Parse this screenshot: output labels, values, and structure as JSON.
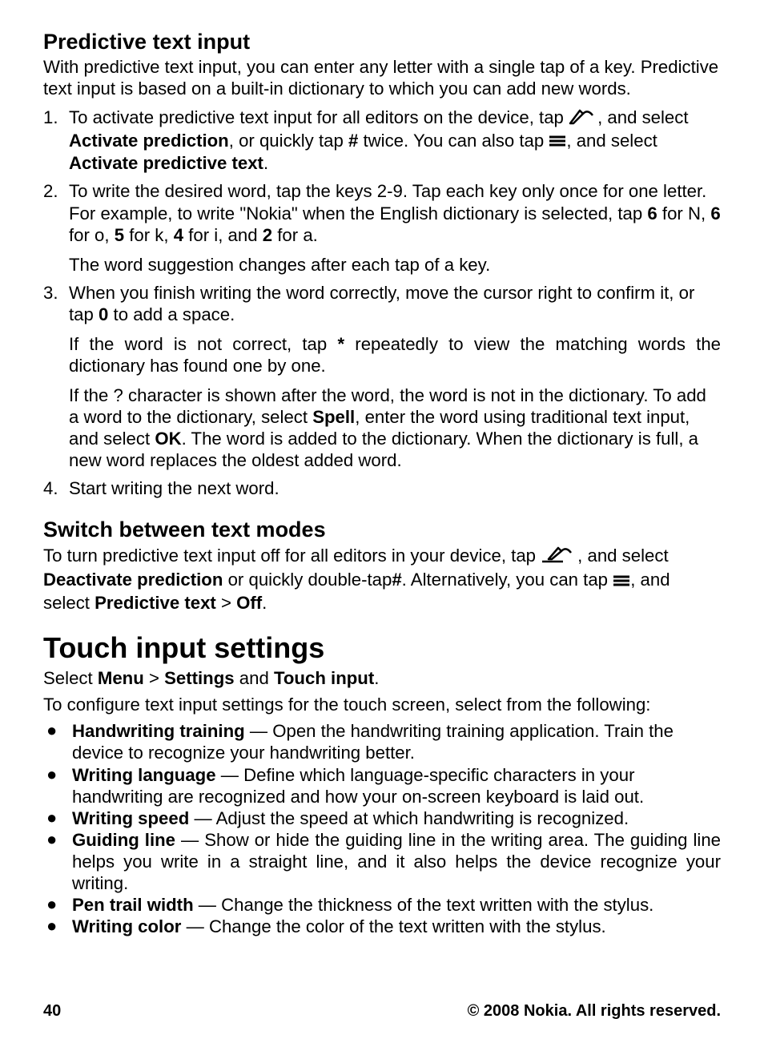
{
  "section1": {
    "heading": "Predictive text input",
    "intro": "With predictive text input, you can enter any letter with a single tap of a key. Predictive text input is based on a built-in dictionary to which you can add new words.",
    "steps": [
      {
        "num": "1.",
        "pre": "To activate predictive text input for all editors on the device, tap ",
        "mid1": ", and select ",
        "b1": "Activate prediction",
        "mid2": ", or quickly tap ",
        "b2": "#",
        "mid3": " twice. You can also tap ",
        "mid4": ", and select ",
        "b3": "Activate predictive text",
        "tail": "."
      },
      {
        "num": "2.",
        "p1a": "To write the desired word, tap the keys 2-9. Tap each key only once for one letter. For example, to write \"Nokia\" when the English dictionary is selected, tap ",
        "k6": "6",
        "t6": " for N, ",
        "k6b": "6",
        "t6b": " for o, ",
        "k5": "5",
        "t5": " for k, ",
        "k4": "4",
        "t4": " for i, and ",
        "k2": "2",
        "t2": " for a.",
        "p2": "The word suggestion changes after each tap of a key."
      },
      {
        "num": "3.",
        "p1a": "When you finish writing the word correctly, move the cursor right to confirm it, or tap ",
        "k0": "0",
        "p1b": " to add a space.",
        "p2a": "If the word is not correct, tap ",
        "kstar": "*",
        "p2b": " repeatedly to view the matching words the dictionary has found one by one.",
        "p3a": "If the ? character is shown after the word, the word is not in the dictionary. To add a word to the dictionary, select ",
        "spell": "Spell",
        "p3b": ", enter the word using traditional text input, and select ",
        "ok": "OK",
        "p3c": ". The word is added to the dictionary. When the dictionary is full, a new word replaces the oldest added word."
      },
      {
        "num": "4.",
        "text": "Start writing the next word."
      }
    ]
  },
  "section2": {
    "heading": "Switch between text modes",
    "pre": "To turn predictive text input off for all editors in your device, tap ",
    "mid1": ", and select ",
    "b1": "Deactivate prediction",
    "mid2": " or quickly double-tap",
    "hash": "#",
    "mid3": ". Alternatively, you can tap ",
    "mid4": ", and select ",
    "b2": "Predictive text",
    "gt": " > ",
    "b3": "Off",
    "tail": "."
  },
  "section3": {
    "heading": "Touch input settings",
    "nav_pre": "Select ",
    "nav_menu": "Menu",
    "nav_gt": " > ",
    "nav_settings": "Settings",
    "nav_and": " and ",
    "nav_touch": "Touch input",
    "nav_tail": ".",
    "intro2": "To configure text input settings for the touch screen, select from the following:",
    "bullets": [
      {
        "name": "Handwriting training",
        "desc": " — Open the handwriting training application. Train the device to recognize your handwriting better."
      },
      {
        "name": "Writing language",
        "desc": " — Define which language-specific characters in your handwriting are recognized and how your on-screen keyboard is laid out."
      },
      {
        "name": "Writing speed",
        "desc": " —  Adjust the speed at which handwriting is recognized."
      },
      {
        "name": "Guiding line",
        "desc": " — Show or hide the guiding line in the writing area. The guiding line helps you write in a straight line, and it also helps the device recognize your writing."
      },
      {
        "name": "Pen trail width",
        "desc": " — Change the thickness of the text written with the stylus."
      },
      {
        "name": "Writing color",
        "desc": " — Change the color of the text written with the stylus."
      }
    ]
  },
  "footer": {
    "page": "40",
    "copyright": "© 2008 Nokia. All rights reserved."
  }
}
